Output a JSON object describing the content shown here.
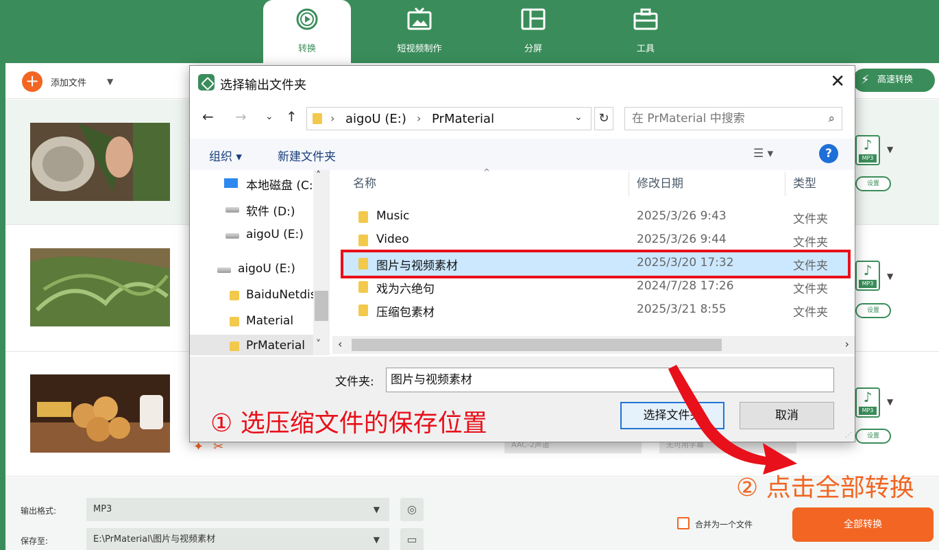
{
  "app": {
    "tabs": [
      {
        "label": "转换",
        "icon": "convert-icon",
        "active": true
      },
      {
        "label": "短视频制作",
        "icon": "tv-icon",
        "active": false
      },
      {
        "label": "分屏",
        "icon": "split-screen-icon",
        "active": false
      },
      {
        "label": "工具",
        "icon": "toolbox-icon",
        "active": false
      }
    ],
    "toolbar": {
      "add_label": "添加文件",
      "fast_label": "高速转换"
    },
    "rows": [
      {
        "format": "MP3",
        "button": "设置"
      },
      {
        "format": "MP3",
        "button": "设置"
      },
      {
        "format": "MP3",
        "button": "设置",
        "audio_sel": "AAC-2声道",
        "sub_sel": "无可用字幕"
      }
    ],
    "bottom": {
      "output_format_label": "输出格式:",
      "output_format_value": "MP3",
      "save_to_label": "保存至:",
      "save_to_value": "E:\\PrMaterial\\图片与视频素材",
      "merge_label": "合并为一个文件",
      "convert_all_label": "全部转换"
    }
  },
  "dialog": {
    "title": "选择输出文件夹",
    "address": [
      "aigoU (E:)",
      "PrMaterial"
    ],
    "search_placeholder": "在 PrMaterial 中搜索",
    "commands": {
      "organize": "组织 ▾",
      "new_folder": "新建文件夹"
    },
    "tree": [
      {
        "label": "本地磁盘 (C:)",
        "icon": "windows-drive-icon"
      },
      {
        "label": "软件 (D:)",
        "icon": "drive-icon"
      },
      {
        "label": "aigoU (E:)",
        "icon": "drive-icon"
      },
      {
        "label": "aigoU (E:)",
        "icon": "drive-icon"
      },
      {
        "label": "BaiduNetdisk",
        "icon": "folder-icon"
      },
      {
        "label": "Material",
        "icon": "folder-icon"
      },
      {
        "label": "PrMaterial",
        "icon": "folder-icon"
      }
    ],
    "columns": {
      "name": "名称",
      "date": "修改日期",
      "type": "类型"
    },
    "files": [
      {
        "name": "Music",
        "date": "2025/3/26 9:43",
        "type": "文件夹"
      },
      {
        "name": "Video",
        "date": "2025/3/26 9:44",
        "type": "文件夹"
      },
      {
        "name": "图片与视频素材",
        "date": "2025/3/20 17:32",
        "type": "文件夹",
        "selected": true
      },
      {
        "name": "戏为六绝句",
        "date": "2024/7/28 17:26",
        "type": "文件夹"
      },
      {
        "name": "压缩包素材",
        "date": "2025/3/21 8:55",
        "type": "文件夹"
      }
    ],
    "folder_label": "文件夹:",
    "folder_value": "图片与视频素材",
    "select_button": "选择文件夹",
    "cancel_button": "取消"
  },
  "annotations": {
    "step1": "① 选压缩文件的保存位置",
    "step2": "② 点击全部转换"
  },
  "colors": {
    "brand_green": "#3a8d5a",
    "accent_orange": "#f26522",
    "annotation_red": "#e8101a"
  }
}
